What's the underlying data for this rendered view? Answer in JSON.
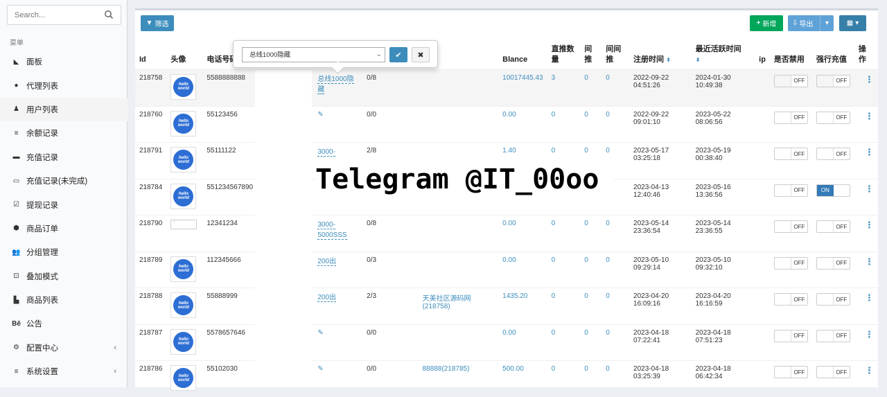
{
  "sidebar": {
    "search_placeholder": "Search...",
    "menu_header": "菜单",
    "items": [
      {
        "label": "面板",
        "icon": "area-chart-icon"
      },
      {
        "label": "代理列表",
        "icon": "circle-icon"
      },
      {
        "label": "用户列表",
        "icon": "user-icon",
        "active": true
      },
      {
        "label": "余额记录",
        "icon": "list-icon"
      },
      {
        "label": "充值记录",
        "icon": "credit-card-icon"
      },
      {
        "label": "充值记录(未完成)",
        "icon": "card-outline-icon"
      },
      {
        "label": "提现记录",
        "icon": "check-square-icon"
      },
      {
        "label": "商品订单",
        "icon": "cube-icon"
      },
      {
        "label": "分组管理",
        "icon": "users-icon"
      },
      {
        "label": "叠加模式",
        "icon": "crop-icon"
      },
      {
        "label": "商品列表",
        "icon": "bar-chart-icon"
      },
      {
        "label": "公告",
        "icon": "behance-icon"
      },
      {
        "label": "配置中心",
        "icon": "gear-icon",
        "chevron": "‹"
      },
      {
        "label": "系统设置",
        "icon": "list-icon",
        "chevron": "‹"
      }
    ]
  },
  "toolbar": {
    "filter_label": "筛选",
    "add_label": "新增",
    "export_label": "导出",
    "columns_icon": "table-icon"
  },
  "table": {
    "headers": {
      "id": "Id",
      "avatar": "头像",
      "phone": "电话号码",
      "balance": "Blance",
      "direct_count_1": "直推数",
      "direct_count_2": "量",
      "indirect_1": "间",
      "indirect_2": "推",
      "indirect2_1": "间间",
      "indirect2_2": "推",
      "reg_time": "注册时间",
      "last_active_1": "最近活跃时间",
      "ip": "ip",
      "disabled": "是否禁用",
      "force_recharge": "强行充值",
      "op": "操",
      "op2": "作"
    },
    "rows": [
      {
        "id": "218758",
        "avatar": "world",
        "phone": "5588888888",
        "group": "总线1000隐藏",
        "group2": "",
        "ratio": "0/8",
        "agent": "",
        "agent2": "",
        "balance": "10017445.43",
        "direct": "3",
        "indirect": "0",
        "indirect2": "0",
        "reg_date": "2022-09-22",
        "reg_time": "04:51:26",
        "act_date": "2024-01-30",
        "act_time": "10:49:38",
        "disabled": "OFF",
        "force": "OFF"
      },
      {
        "id": "218760",
        "avatar": "world",
        "phone": "55123456",
        "group": "",
        "group2": "",
        "ratio": "0/0",
        "agent": "",
        "agent2": "",
        "balance": "0.00",
        "direct": "0",
        "indirect": "0",
        "indirect2": "0",
        "reg_date": "2022-09-22",
        "reg_time": "09:01:10",
        "act_date": "2023-05-22",
        "act_time": "08:06:56",
        "disabled": "OFF",
        "force": "OFF"
      },
      {
        "id": "218791",
        "avatar": "world",
        "phone": "55111122",
        "group": "3000-",
        "group2": "",
        "ratio": "2/8",
        "agent": "",
        "agent2": "",
        "balance": "1.40",
        "direct": "0",
        "indirect": "0",
        "indirect2": "0",
        "reg_date": "2023-05-17",
        "reg_time": "03:25:18",
        "act_date": "2023-05-19",
        "act_time": "00:38:40",
        "disabled": "OFF",
        "force": "OFF"
      },
      {
        "id": "218784",
        "avatar": "world",
        "phone": "551234567890",
        "group": "",
        "group2": "",
        "ratio": "",
        "agent": "",
        "agent2": "",
        "balance": "",
        "direct": "",
        "indirect": "",
        "indirect2": "",
        "reg_date": "2023-04-13",
        "reg_time": "12:40:46",
        "act_date": "2023-05-16",
        "act_time": "13:36:56",
        "disabled": "OFF",
        "force": "ON"
      },
      {
        "id": "218790",
        "avatar": "broken",
        "phone": "12341234",
        "group": "3000-",
        "group2": "5000SSS",
        "ratio": "0/8",
        "agent": "",
        "agent2": "",
        "balance": "0.00",
        "direct": "0",
        "indirect": "0",
        "indirect2": "0",
        "reg_date": "2023-05-14",
        "reg_time": "23:36:54",
        "act_date": "2023-05-14",
        "act_time": "23:36:55",
        "disabled": "OFF",
        "force": "OFF"
      },
      {
        "id": "218789",
        "avatar": "world",
        "phone": "112345666",
        "group": "200出",
        "group2": "",
        "ratio": "0/3",
        "agent": "",
        "agent2": "",
        "balance": "0.00",
        "direct": "0",
        "indirect": "0",
        "indirect2": "0",
        "reg_date": "2023-05-10",
        "reg_time": "09:29:14",
        "act_date": "2023-05-10",
        "act_time": "09:32:10",
        "disabled": "OFF",
        "force": "OFF"
      },
      {
        "id": "218788",
        "avatar": "world",
        "phone": "55888999",
        "group": "200出",
        "group2": "",
        "ratio": "2/3",
        "agent": "天美社区源码网",
        "agent2": "(218758)",
        "balance": "1435.20",
        "direct": "0",
        "indirect": "0",
        "indirect2": "0",
        "reg_date": "2023-04-20",
        "reg_time": "16:09:16",
        "act_date": "2023-04-20",
        "act_time": "16:16:59",
        "disabled": "OFF",
        "force": "OFF"
      },
      {
        "id": "218787",
        "avatar": "world",
        "phone": "5578657646",
        "group": "",
        "group2": "",
        "ratio": "0/0",
        "agent": "",
        "agent2": "",
        "balance": "0.00",
        "direct": "0",
        "indirect": "0",
        "indirect2": "0",
        "reg_date": "2023-04-18",
        "reg_time": "07:22:41",
        "act_date": "2023-04-18",
        "act_time": "07:51:23",
        "disabled": "OFF",
        "force": "OFF"
      },
      {
        "id": "218786",
        "avatar": "world",
        "phone": "55102030",
        "group": "",
        "group2": "",
        "ratio": "0/0",
        "agent": "88888(218785)",
        "agent2": "",
        "balance": "500.00",
        "direct": "0",
        "indirect": "0",
        "indirect2": "0",
        "reg_date": "2023-04-18",
        "reg_time": "03:25:39",
        "act_date": "2023-04-18",
        "act_time": "06:42:34",
        "disabled": "OFF",
        "force": "OFF"
      }
    ]
  },
  "popover": {
    "selected": "总线1000隐藏"
  },
  "avatar_text": "hello world",
  "watermark": "Telegram @IT_00oo",
  "colors": {
    "primary": "#3c8dbc",
    "success": "#00a65a",
    "on_toggle": "#337ab7"
  }
}
